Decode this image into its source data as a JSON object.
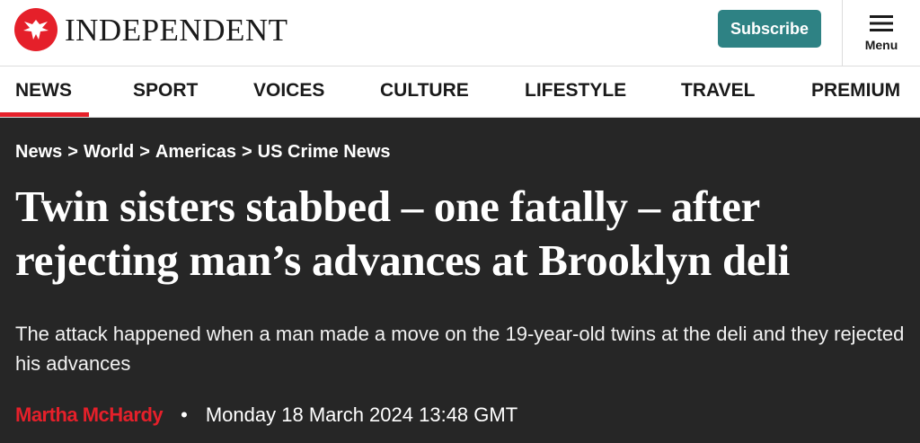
{
  "header": {
    "logo_text": "INDEPENDENT",
    "subscribe_label": "Subscribe",
    "menu_label": "Menu",
    "brand_color": "#e5202a",
    "subscribe_color": "#2e8284"
  },
  "nav": {
    "items": [
      {
        "label": "NEWS",
        "active": true
      },
      {
        "label": "SPORT"
      },
      {
        "label": "VOICES"
      },
      {
        "label": "CULTURE"
      },
      {
        "label": "LIFESTYLE"
      },
      {
        "label": "TRAVEL"
      },
      {
        "label": "PREMIUM"
      }
    ]
  },
  "article": {
    "breadcrumb": [
      "News",
      "World",
      "Americas",
      "US Crime News"
    ],
    "breadcrumb_separator": ">",
    "headline": "Twin sisters stabbed – one fatally – after rejecting man’s advances at Brooklyn deli",
    "standfirst": "The attack happened when a man made a move on the 19-year-old twins at the deli and they rejected his advances",
    "author": "Martha McHardy",
    "byline_separator": "•",
    "date": "Monday 18 March 2024 13:48 GMT"
  },
  "icons": {
    "logo": "eagle-icon",
    "menu": "hamburger-icon"
  }
}
